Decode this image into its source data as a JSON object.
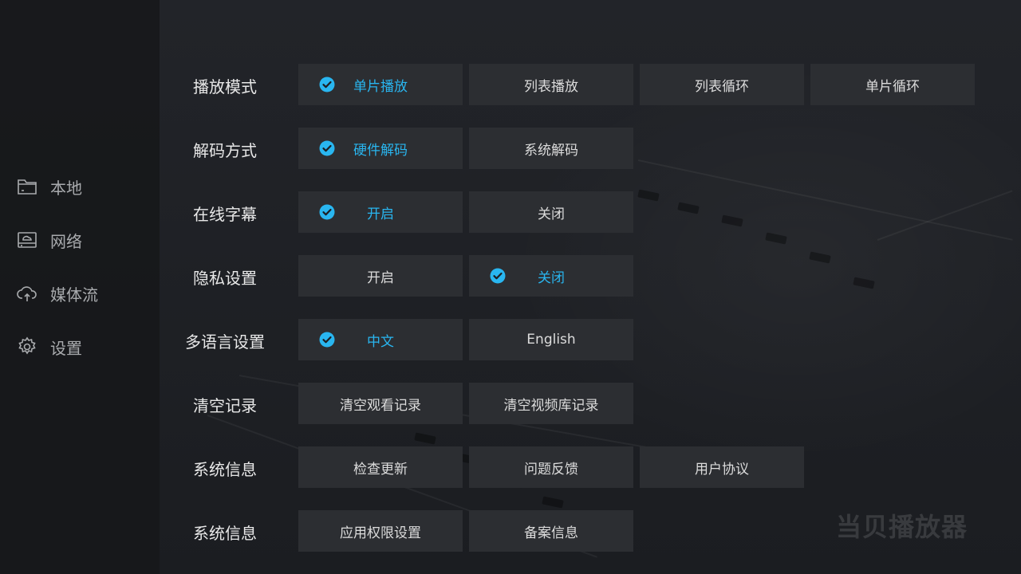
{
  "sidebar": {
    "items": [
      {
        "label": "本地",
        "icon": "folder-icon"
      },
      {
        "label": "网络",
        "icon": "network-drive-icon"
      },
      {
        "label": "媒体流",
        "icon": "cloud-upload-icon"
      },
      {
        "label": "设置",
        "icon": "gear-icon"
      }
    ]
  },
  "settings": {
    "rows": [
      {
        "label": "播放模式",
        "options": [
          {
            "label": "单片播放",
            "selected": true
          },
          {
            "label": "列表播放",
            "selected": false
          },
          {
            "label": "列表循环",
            "selected": false
          },
          {
            "label": "单片循环",
            "selected": false
          }
        ]
      },
      {
        "label": "解码方式",
        "options": [
          {
            "label": "硬件解码",
            "selected": true
          },
          {
            "label": "系统解码",
            "selected": false
          }
        ]
      },
      {
        "label": "在线字幕",
        "options": [
          {
            "label": "开启",
            "selected": true
          },
          {
            "label": "关闭",
            "selected": false
          }
        ]
      },
      {
        "label": "隐私设置",
        "options": [
          {
            "label": "开启",
            "selected": false
          },
          {
            "label": "关闭",
            "selected": true
          }
        ]
      },
      {
        "label": "多语言设置",
        "options": [
          {
            "label": "中文",
            "selected": true
          },
          {
            "label": "English",
            "selected": false
          }
        ]
      },
      {
        "label": "清空记录",
        "options": [
          {
            "label": "清空观看记录",
            "selected": false
          },
          {
            "label": "清空视频库记录",
            "selected": false
          }
        ]
      },
      {
        "label": "系统信息",
        "options": [
          {
            "label": "检查更新",
            "selected": false
          },
          {
            "label": "问题反馈",
            "selected": false
          },
          {
            "label": "用户协议",
            "selected": false
          }
        ]
      },
      {
        "label": "系统信息",
        "options": [
          {
            "label": "应用权限设置",
            "selected": false
          },
          {
            "label": "备案信息",
            "selected": false
          }
        ]
      }
    ]
  },
  "watermark": "当贝播放器",
  "colors": {
    "accent": "#29b6f0",
    "option_bg": "#2c2e32",
    "background": "#1d1f23"
  }
}
